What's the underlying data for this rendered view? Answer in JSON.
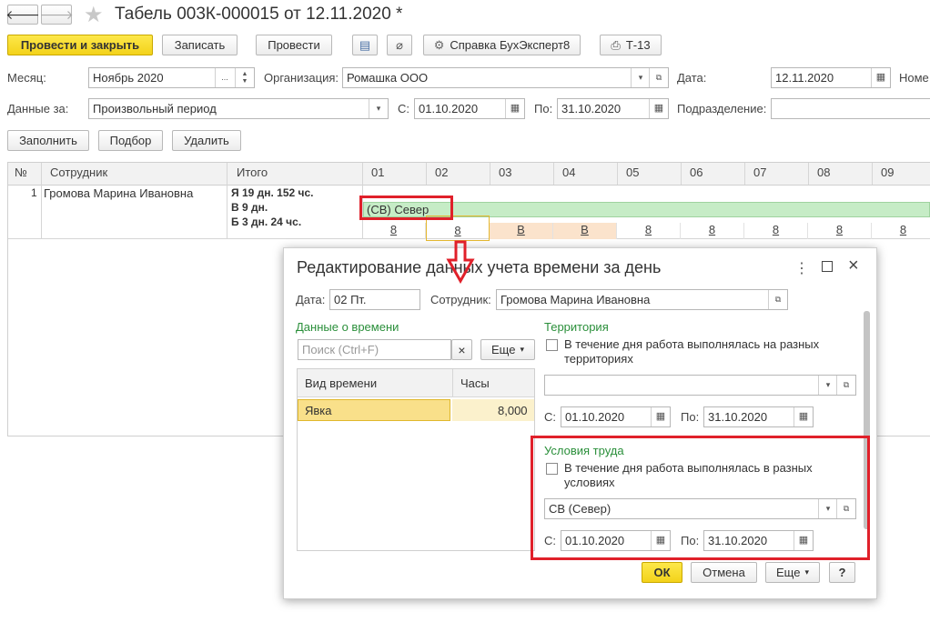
{
  "window": {
    "title": "Табель 003К-000015 от 12.11.2020 *",
    "back_label": "🡐",
    "forward_label": "🡒",
    "star_label": "★"
  },
  "toolbar": {
    "post_close_label": "Провести и закрыть",
    "save_label": "Записать",
    "post_label": "Провести",
    "reference_label": "Справка БухЭксперт8",
    "t13_label": "Т-13"
  },
  "form": {
    "month_label": "Месяц:",
    "month_value": "Ноябрь 2020",
    "org_label": "Организация:",
    "org_value": "Ромашка ООО",
    "date_label": "Дата:",
    "date_value": "12.11.2020",
    "number_label": "Номе",
    "data_for_label": "Данные за:",
    "data_for_value": "Произвольный период",
    "from_label": "С:",
    "from_value": "01.10.2020",
    "to_label": "По:",
    "to_value": "31.10.2020",
    "division_label": "Подразделение:",
    "division_value": ""
  },
  "actions": {
    "fill_label": "Заполнить",
    "select_label": "Подбор",
    "delete_label": "Удалить"
  },
  "table": {
    "headers": {
      "num": "№",
      "employee": "Сотрудник",
      "total": "Итого"
    },
    "days": [
      "01",
      "02",
      "03",
      "04",
      "05",
      "06",
      "07",
      "08",
      "09"
    ],
    "row": {
      "num": "1",
      "employee": "Громова Марина Ивановна",
      "total_lines": [
        "Я 19 дн. 152 чс.",
        "В 9 дн.",
        "Б 3 дн. 24 чс."
      ],
      "territory": "(СВ) Север",
      "values": [
        "8",
        "8",
        "В",
        "В",
        "8",
        "8",
        "8",
        "8",
        "8"
      ]
    }
  },
  "dialog": {
    "title": "Редактирование данных учета времени за день",
    "date_label": "Дата:",
    "date_value": "02 Пт.",
    "employee_label": "Сотрудник:",
    "employee_value": "Громова Марина Ивановна",
    "time_data_title": "Данные о времени",
    "search_placeholder": "Поиск (Ctrl+F)",
    "more_label": "Еще",
    "time_table": {
      "headers": [
        "Вид времени",
        "Часы"
      ],
      "rows": [
        {
          "kind": "Явка",
          "hours": "8,000"
        }
      ]
    },
    "territory_title": "Территория",
    "territory_checkbox": "В течение дня работа выполнялась на разных территориях",
    "territory_value": "",
    "territory_from_label": "С:",
    "territory_from": "01.10.2020",
    "territory_to_label": "По:",
    "territory_to": "31.10.2020",
    "conditions_title": "Условия труда",
    "conditions_checkbox": "В течение дня работа выполнялась в разных условиях",
    "conditions_value": "СВ (Север)",
    "conditions_from_label": "С:",
    "conditions_from": "01.10.2020",
    "conditions_to_label": "По:",
    "conditions_to": "31.10.2020",
    "ok_label": "ОК",
    "cancel_label": "Отмена",
    "more2_label": "Еще",
    "help_label": "?"
  },
  "colors": {
    "accent_yellow": "#f5d62a",
    "highlight_red": "#e0202a",
    "territory_green": "#c6ecc6",
    "weekend_peach": "#fbe3cc",
    "section_green": "#2a8f3a"
  }
}
